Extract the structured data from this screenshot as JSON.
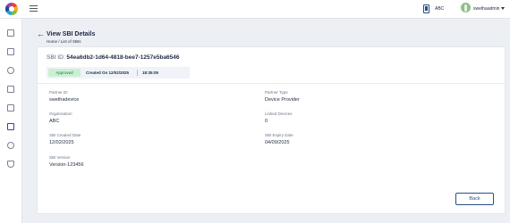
{
  "topbar": {
    "language": "ABC",
    "username": "swethaadmin"
  },
  "header": {
    "title": "View SBI Details",
    "breadcrumb": "Home / List of SBIs"
  },
  "sbi": {
    "id_label": "SBI ID:",
    "id_value": "54ea6db2-1d64-4818-bee7-1257e5ba6546",
    "status": "Approved",
    "created_on": "Created On 12/02/2025",
    "created_time": "18:35:05"
  },
  "fields": {
    "partner_id": {
      "label": "Partner ID",
      "value": "swethadevice"
    },
    "partner_type": {
      "label": "Partner Type",
      "value": "Device Provider"
    },
    "organisation": {
      "label": "Organisation",
      "value": "ABC"
    },
    "linked_devices": {
      "label": "Linked Devices",
      "value": "0"
    },
    "created_date": {
      "label": "SBI Created Date",
      "value": "12/02/2025"
    },
    "expiry_date": {
      "label": "SBI Expiry Date",
      "value": "04/09/2025"
    },
    "version": {
      "label": "SBI Version",
      "value": "Version-123456"
    }
  },
  "actions": {
    "back_label": "Back"
  },
  "colors": {
    "accent": "#2a4d8f",
    "approved_bg": "#c9efd4",
    "approved_text": "#1e7a3c"
  },
  "icons": {
    "logo": "app-logo",
    "menu": "hamburger-icon",
    "bookmark": "bookmark-icon",
    "user": "user-avatar",
    "dropdown": "chevron-down-icon",
    "back": "arrow-left-icon"
  }
}
